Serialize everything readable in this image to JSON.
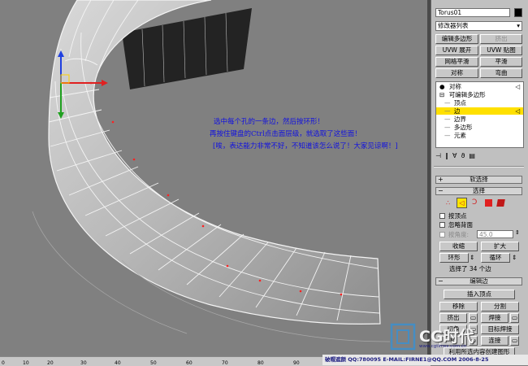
{
  "viewport": {
    "notes": [
      "选中每个孔的一条边，然后按环形！",
      "再按住键盘的Ctrl点击面层级，就选取了这些面！",
      "[唉，表达能力非常不好，不知道该怎么说了！大家见谅啊！]"
    ]
  },
  "ruler": {
    "ticks": [
      "0",
      "10",
      "20",
      "30",
      "40",
      "50",
      "60",
      "70",
      "80",
      "90"
    ]
  },
  "panel": {
    "object_name": "Torus01",
    "modifier_list": "修改器列表",
    "buttons": [
      {
        "label": "编辑多边形",
        "dim": false
      },
      {
        "label": "挤出",
        "dim": true
      },
      {
        "label": "UVW 展开",
        "dim": false
      },
      {
        "label": "UVW 贴图",
        "dim": false
      },
      {
        "label": "网格平滑",
        "dim": false
      },
      {
        "label": "平滑",
        "dim": false
      },
      {
        "label": "对称",
        "dim": false
      },
      {
        "label": "弯曲",
        "dim": false
      }
    ],
    "stack": [
      {
        "label": "对称",
        "prefix": "●",
        "indent": 0,
        "selected": false
      },
      {
        "label": "可编辑多边形",
        "prefix": "⊟",
        "indent": 0,
        "selected": false
      },
      {
        "label": "顶点",
        "prefix": "—",
        "indent": 1,
        "selected": false
      },
      {
        "label": "边",
        "prefix": "—",
        "indent": 1,
        "selected": true
      },
      {
        "label": "边界",
        "prefix": "—",
        "indent": 1,
        "selected": false
      },
      {
        "label": "多边形",
        "prefix": "—",
        "indent": 1,
        "selected": false
      },
      {
        "label": "元素",
        "prefix": "—",
        "indent": 1,
        "selected": false
      }
    ],
    "soft_selection": "软选择",
    "selection": {
      "title": "选择",
      "by_vertex": "按顶点",
      "ignore_backfacing": "忽略背面",
      "by_angle": "按角度:",
      "angle_value": "45.0",
      "shrink": "收缩",
      "grow": "扩大",
      "ring": "环形",
      "loop": "循环",
      "status": "选择了 34 个边"
    },
    "edit_edges": {
      "title": "编辑边",
      "insert_vertex": "插入顶点",
      "remove": "移除",
      "split": "分割",
      "extrude": "挤出",
      "weld": "焊接",
      "chamfer": "切角",
      "target_weld": "目标焊接",
      "bridge": "桥",
      "connect": "连接",
      "create_shape": "利用所选内容创建图形"
    }
  },
  "watermark": {
    "logo_text": "CG时代",
    "site": "www.cgtimes.com.cn"
  },
  "credit": {
    "text": "破帽遮颜 QQ:780095 E-MAIL:FIRNE1@QQ.COM 2006-8-25"
  },
  "colors": {
    "annotation": "#1010e0",
    "stack_selection": "#ffe000",
    "viewport_bg": "#808080"
  }
}
